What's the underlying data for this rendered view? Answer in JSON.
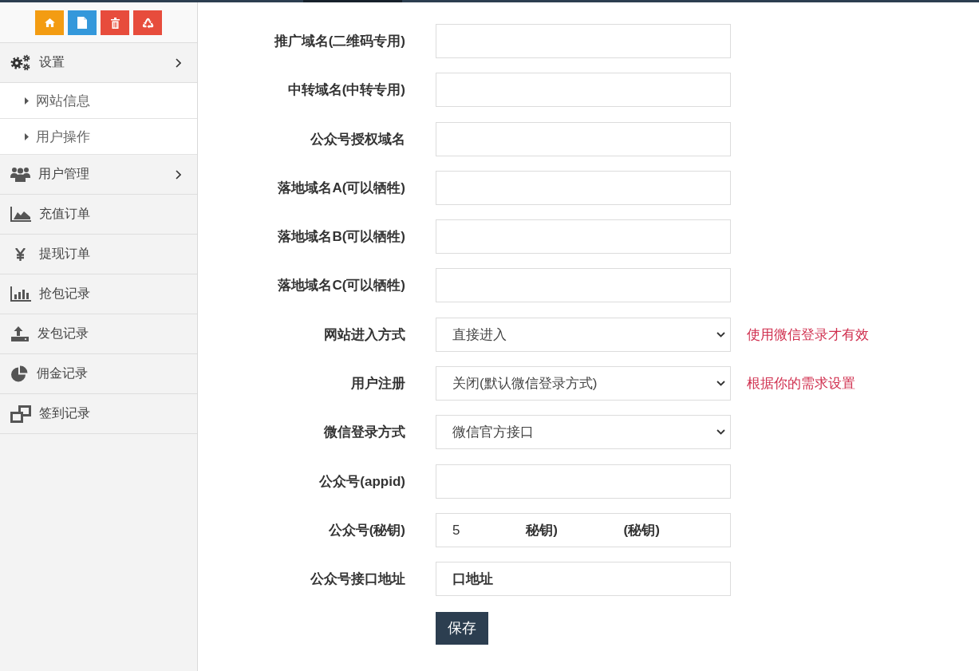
{
  "toolbar_buttons": [
    {
      "color": "#f39c12"
    },
    {
      "color": "#3498db"
    },
    {
      "color": "#e74c3c"
    },
    {
      "color": "#e74c3c"
    }
  ],
  "sidebar": {
    "items": [
      {
        "label": "设置",
        "kind": "submenu",
        "children": [
          {
            "label": "网站信息"
          },
          {
            "label": "用户操作"
          }
        ]
      },
      {
        "label": "用户管理",
        "kind": "submenu"
      },
      {
        "label": "充值订单",
        "kind": "link"
      },
      {
        "label": "提现订单",
        "kind": "link"
      },
      {
        "label": "抢包记录",
        "kind": "link"
      },
      {
        "label": "发包记录",
        "kind": "link"
      },
      {
        "label": "佣金记录",
        "kind": "link"
      },
      {
        "label": "签到记录",
        "kind": "link"
      }
    ]
  },
  "form": {
    "rows": [
      {
        "label": "推广域名(二维码专用)",
        "kind": "text"
      },
      {
        "label": "中转域名(中转专用)",
        "kind": "text"
      },
      {
        "label": "公众号授权域名",
        "kind": "text"
      },
      {
        "label": "落地域名A(可以牺牲)",
        "kind": "text"
      },
      {
        "label": "落地域名B(可以牺牲)",
        "kind": "text"
      },
      {
        "label": "落地域名C(可以牺牲)",
        "kind": "text"
      },
      {
        "label": "网站进入方式",
        "kind": "select",
        "value": "直接进入",
        "hint": "使用微信登录才有效"
      },
      {
        "label": "用户注册",
        "kind": "select",
        "value": "关闭(默认微信登录方式)",
        "hint": "根据你的需求设置"
      },
      {
        "label": "微信登录方式",
        "kind": "select",
        "value": "微信官方接口"
      },
      {
        "label": "公众号(appid)",
        "kind": "text"
      },
      {
        "label": "公众号(秘钥)",
        "kind": "text",
        "value": "5 **秘钥)** **(秘钥)**"
      },
      {
        "label": "公众号接口地址",
        "kind": "text",
        "value": "**口地址**"
      }
    ],
    "save_button": "保存"
  }
}
